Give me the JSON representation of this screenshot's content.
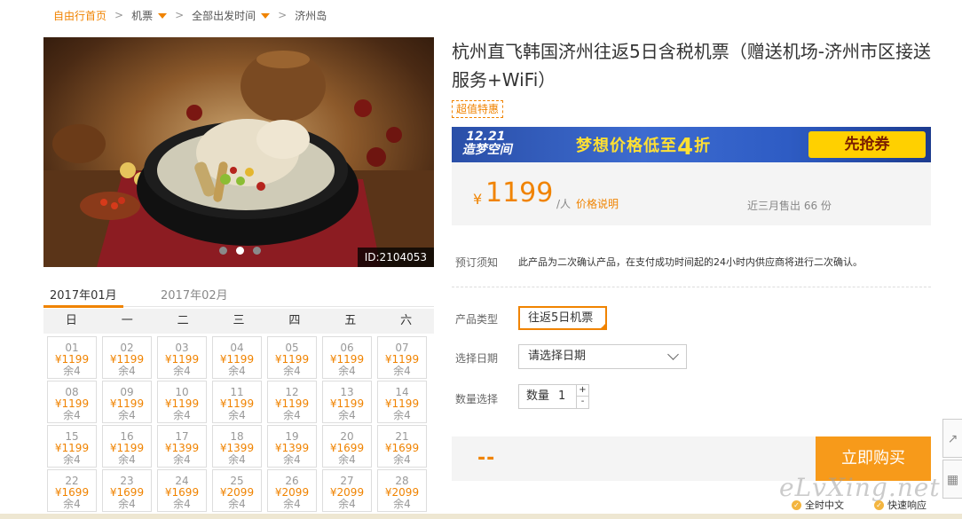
{
  "breadcrumb": {
    "home": "自由行首页",
    "flights": "机票",
    "departure": "全部出发时间",
    "destination": "济州岛",
    "separator": ">"
  },
  "hero": {
    "image_id": "ID:2104053",
    "slide_count": 3,
    "active_slide": 2
  },
  "product": {
    "title": "杭州直飞韩国济州往返5日含税机票（赠送机场-济州市区接送服务+WiFi）",
    "badge": "超值特惠"
  },
  "banner": {
    "logo_line1": "12.21",
    "logo_line2": "造梦空间",
    "slogan_prefix": "梦想价格低至",
    "slogan_number": "4",
    "slogan_suffix": "折",
    "cta": "先抢券"
  },
  "pricing": {
    "currency": "¥",
    "price": "1199",
    "per": "/人",
    "price_note": "价格说明",
    "sold": "近三月售出 66 份"
  },
  "booking": {
    "notice_label": "预订须知",
    "notice_text": "此产品为二次确认产品，在支付成功时间起的24小时内供应商将进行二次确认。",
    "type_label": "产品类型",
    "type_value": "往返5日机票",
    "date_label": "选择日期",
    "date_placeholder": "请选择日期",
    "qty_label": "数量选择",
    "qty_prefix": "数量",
    "qty_value": "1",
    "plus": "+",
    "minus": "-"
  },
  "buy": {
    "total": "--",
    "button": "立即购买"
  },
  "calendar": {
    "tabs": [
      "2017年01月",
      "2017年02月"
    ],
    "weekdays": [
      "日",
      "一",
      "二",
      "三",
      "四",
      "五",
      "六"
    ],
    "days": [
      {
        "d": "01",
        "p": "¥1199",
        "s": "余4"
      },
      {
        "d": "02",
        "p": "¥1199",
        "s": "余4"
      },
      {
        "d": "03",
        "p": "¥1199",
        "s": "余4"
      },
      {
        "d": "04",
        "p": "¥1199",
        "s": "余4"
      },
      {
        "d": "05",
        "p": "¥1199",
        "s": "余4"
      },
      {
        "d": "06",
        "p": "¥1199",
        "s": "余4"
      },
      {
        "d": "07",
        "p": "¥1199",
        "s": "余4"
      },
      {
        "d": "08",
        "p": "¥1199",
        "s": "余4"
      },
      {
        "d": "09",
        "p": "¥1199",
        "s": "余4"
      },
      {
        "d": "10",
        "p": "¥1199",
        "s": "余4"
      },
      {
        "d": "11",
        "p": "¥1199",
        "s": "余4"
      },
      {
        "d": "12",
        "p": "¥1199",
        "s": "余4"
      },
      {
        "d": "13",
        "p": "¥1199",
        "s": "余4"
      },
      {
        "d": "14",
        "p": "¥1199",
        "s": "余4"
      },
      {
        "d": "15",
        "p": "¥1199",
        "s": "余4"
      },
      {
        "d": "16",
        "p": "¥1199",
        "s": "余4"
      },
      {
        "d": "17",
        "p": "¥1399",
        "s": "余4"
      },
      {
        "d": "18",
        "p": "¥1399",
        "s": "余4"
      },
      {
        "d": "19",
        "p": "¥1399",
        "s": "余4"
      },
      {
        "d": "20",
        "p": "¥1699",
        "s": "余4"
      },
      {
        "d": "21",
        "p": "¥1699",
        "s": "余4"
      },
      {
        "d": "22",
        "p": "¥1699",
        "s": "余4"
      },
      {
        "d": "23",
        "p": "¥1699",
        "s": "余4"
      },
      {
        "d": "24",
        "p": "¥1699",
        "s": "余4"
      },
      {
        "d": "25",
        "p": "¥2099",
        "s": "余4"
      },
      {
        "d": "26",
        "p": "¥2099",
        "s": "余4"
      },
      {
        "d": "27",
        "p": "¥2099",
        "s": "余4"
      },
      {
        "d": "28",
        "p": "¥2099",
        "s": "余4"
      }
    ]
  },
  "footer": {
    "watermark": "eLvXing.net",
    "item1": "全时中文",
    "item2": "快速响应"
  },
  "colors": {
    "accent": "#f08300",
    "buy_button": "#f79a1a",
    "banner_blue": "#2e5cc4",
    "banner_yellow": "#ffd000"
  }
}
